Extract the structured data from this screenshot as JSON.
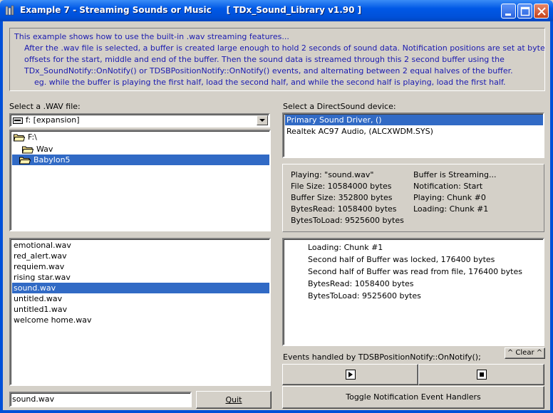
{
  "window": {
    "title": "Example 7 - Streaming Sounds or Music     [ TDx_Sound_Library v1.90 ]"
  },
  "description": [
    "This example shows how to use the built-in .wav streaming features...",
    "    After the .wav file is selected, a buffer is created large enough to hold 2 seconds of sound data. Notification positions are set at byte",
    "    offsets for the start, middle and end of the buffer. Then the sound data is streamed through this 2 second buffer using the",
    "    TDx_SoundNotify::OnNotify() or TDSBPositionNotify::OnNotify() events, and alternating between 2 equal halves of the buffer.",
    "        eg. while the buffer is playing the first half, load the second half, and while the second half is playing, load the first half."
  ],
  "wav_panel": {
    "label": "Select a .WAV file:",
    "drive": "f: [expansion]",
    "folders": [
      "F:\\",
      "Wav",
      "Babylon5"
    ],
    "files": [
      "emotional.wav",
      "red_alert.wav",
      "requiem.wav",
      "rising star.wav",
      "sound.wav",
      "untitled.wav",
      "untitled1.wav",
      "welcome home.wav"
    ],
    "selected_file": "sound.wav",
    "filename_value": "sound.wav",
    "quit_label": "Quit"
  },
  "device_panel": {
    "label": "Select a DirectSound device:",
    "devices": [
      "Primary Sound Driver, ()",
      "Realtek AC97 Audio, (ALCXWDM.SYS)"
    ]
  },
  "status": {
    "left": [
      "Playing: \"sound.wav\"",
      "File Size: 10584000 bytes",
      "Buffer Size: 352800 bytes",
      "BytesRead: 1058400 bytes",
      "BytesToLoad: 9525600 bytes"
    ],
    "right": [
      "Buffer is Streaming...",
      "Notification: Start",
      "Playing: Chunk #0",
      "Loading: Chunk #1"
    ]
  },
  "log": {
    "lines": [
      "Loading: Chunk #1",
      "Second half of Buffer was locked, 176400 bytes",
      "Second half of Buffer was read from file, 176400 bytes",
      "BytesRead: 1058400 bytes",
      "BytesToLoad: 9525600 bytes"
    ],
    "events_label": "Events handled by TDSBPositionNotify::OnNotify();",
    "clear_label": "^ Clear ^"
  },
  "controls": {
    "toggle_label": "Toggle Notification Event Handlers"
  }
}
